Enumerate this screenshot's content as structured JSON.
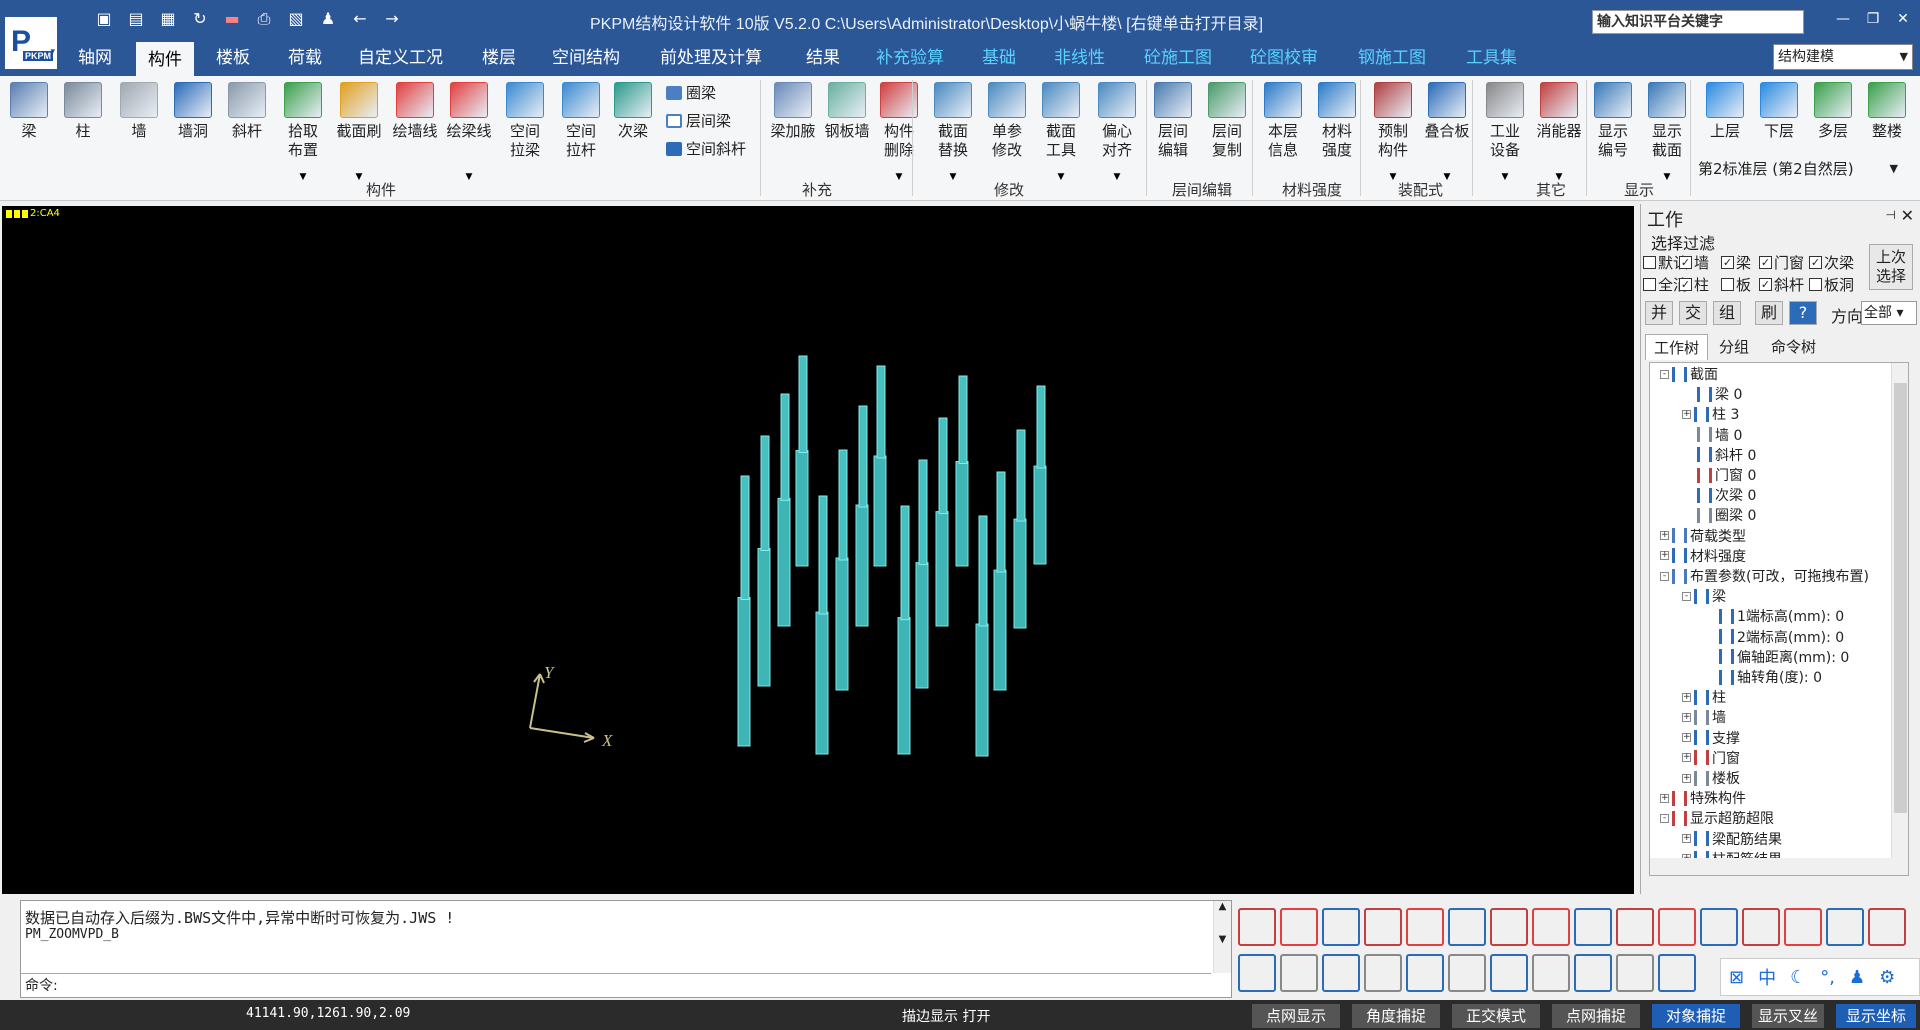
{
  "titlebar": {
    "title": "PKPM结构设计软件 10版 V5.2.0 C:\\Users\\Administrator\\Desktop\\小蜗牛楼\\  [右键单击打开目录]",
    "search_placeholder": "输入知识平台关键字",
    "quick_access": [
      "save-icon",
      "save-as-icon",
      "print-preview-icon",
      "refresh-icon",
      "delete-icon",
      "print-icon",
      "clipboard-icon",
      "user-icon",
      "undo-icon",
      "redo-icon"
    ],
    "window_controls": [
      "minimize",
      "restore",
      "close"
    ]
  },
  "logo": {
    "text": "PKPM"
  },
  "menu": {
    "tabs": [
      "轴网",
      "构件",
      "楼板",
      "荷载",
      "自定义工况",
      "楼层",
      "空间结构",
      "前处理及计算",
      "结果",
      "补充验算",
      "基础",
      "非线性",
      "砼施工图",
      "砼图校审",
      "钢施工图",
      "工具集"
    ],
    "active": "构件",
    "mode": "结构建模"
  },
  "ribbon": {
    "buttons": [
      "梁",
      "柱",
      "墙",
      "墙洞",
      "斜杆",
      "拾取\n布置",
      "截面刷",
      "绘墙线",
      "绘梁线",
      "空间\n拉梁",
      "空间\n拉杆",
      "次梁",
      "梁加腋",
      "钢板墙",
      "构件\n删除",
      "截面\n替换",
      "单参\n修改",
      "截面\n工具",
      "偏心\n对齐",
      "层间\n编辑",
      "层间\n复制",
      "本层\n信息",
      "材料\n强度",
      "预制\n构件",
      "叠合板",
      "工业\n设备",
      "消能器",
      "显示\n编号",
      "显示\n截面",
      "上层",
      "下层",
      "多层",
      "整楼"
    ],
    "small_buttons": [
      "圈梁",
      "层间梁",
      "空间斜杆"
    ],
    "groups": [
      "构件",
      "补充",
      "修改",
      "层间编辑",
      "材料强度",
      "装配式",
      "其它",
      "显示"
    ],
    "floor": "第2标准层 (第2自然层)"
  },
  "viewport": {
    "tag": "2:CA4",
    "axis_x": "X",
    "axis_y": "Y"
  },
  "workpanel": {
    "title": "工作",
    "filter_title": "选择过滤",
    "checkboxes_row1": [
      {
        "label": "默认",
        "checked": false
      },
      {
        "label": "墙",
        "checked": true
      },
      {
        "label": "梁",
        "checked": true
      },
      {
        "label": "门窗",
        "checked": true
      },
      {
        "label": "次梁",
        "checked": true
      }
    ],
    "checkboxes_row2": [
      {
        "label": "全消",
        "checked": false
      },
      {
        "label": "柱",
        "checked": true
      },
      {
        "label": "板",
        "checked": false
      },
      {
        "label": "斜杆",
        "checked": true
      },
      {
        "label": "板洞",
        "checked": false
      }
    ],
    "last_select": "上次\n选择",
    "ops": [
      "并",
      "交",
      "组",
      "刷",
      "?"
    ],
    "direction_label": "方向",
    "direction_value": "全部",
    "tabs": [
      "工作树",
      "分组",
      "命令树"
    ],
    "active_tab": "工作树",
    "tree": [
      {
        "label": "截面",
        "level": 0,
        "expand": "-"
      },
      {
        "label": "梁 0",
        "level": 1,
        "expand": ""
      },
      {
        "label": "柱 3",
        "level": 1,
        "expand": "+"
      },
      {
        "label": "墙 0",
        "level": 1,
        "expand": ""
      },
      {
        "label": "斜杆 0",
        "level": 1,
        "expand": ""
      },
      {
        "label": "门窗 0",
        "level": 1,
        "expand": ""
      },
      {
        "label": "次梁 0",
        "level": 1,
        "expand": ""
      },
      {
        "label": "圈梁 0",
        "level": 1,
        "expand": ""
      },
      {
        "label": "荷载类型",
        "level": 0,
        "expand": "+"
      },
      {
        "label": "材料强度",
        "level": 0,
        "expand": "+"
      },
      {
        "label": "布置参数(可改，可拖拽布置)",
        "level": 0,
        "expand": "-"
      },
      {
        "label": "梁",
        "level": 1,
        "expand": "-"
      },
      {
        "label": "1端标高(mm): 0",
        "level": 2,
        "expand": ""
      },
      {
        "label": "2端标高(mm): 0",
        "level": 2,
        "expand": ""
      },
      {
        "label": "偏轴距离(mm): 0",
        "level": 2,
        "expand": ""
      },
      {
        "label": "轴转角(度): 0",
        "level": 2,
        "expand": ""
      },
      {
        "label": "柱",
        "level": 1,
        "expand": "+"
      },
      {
        "label": "墙",
        "level": 1,
        "expand": "+"
      },
      {
        "label": "支撑",
        "level": 1,
        "expand": "+"
      },
      {
        "label": "门窗",
        "level": 1,
        "expand": "+"
      },
      {
        "label": "楼板",
        "level": 1,
        "expand": "+"
      },
      {
        "label": "特殊构件",
        "level": 0,
        "expand": "+"
      },
      {
        "label": "显示超筋超限",
        "level": 0,
        "expand": "-"
      },
      {
        "label": "梁配筋结果",
        "level": 1,
        "expand": "+"
      },
      {
        "label": "柱配筋结果",
        "level": 1,
        "expand": "+"
      }
    ]
  },
  "command": {
    "line1": "数据已自动存入后缀为.BWS文件中,异常中断时可恢复为.JWS !",
    "line2": "PM_ZOOMVPD_B",
    "prompt": "命令:"
  },
  "lang": [
    "中",
    "☾",
    "°,",
    "♟",
    "⚙"
  ],
  "status": {
    "coords": "41141.90,1261.90,2.09",
    "edge_display": "描边显示 打开",
    "toggles": [
      {
        "label": "点网显示",
        "on": false
      },
      {
        "label": "角度捕捉",
        "on": false
      },
      {
        "label": "正交模式",
        "on": false
      },
      {
        "label": "点网捕捉",
        "on": false
      },
      {
        "label": "对象捕捉",
        "on": true
      },
      {
        "label": "显示叉丝",
        "on": false
      },
      {
        "label": "显示坐标",
        "on": true
      }
    ]
  }
}
